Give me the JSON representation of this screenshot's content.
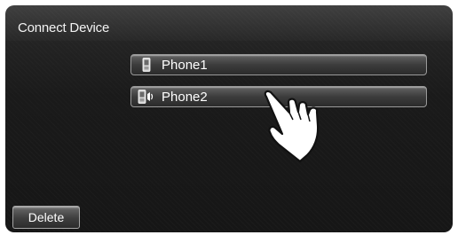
{
  "screen": {
    "title": "Connect Device"
  },
  "devices": [
    {
      "label": "Phone1",
      "icon": "phone-icon"
    },
    {
      "label": "Phone2",
      "icon": "phone-audio-icon"
    }
  ],
  "footer": {
    "delete_label": "Delete"
  },
  "overlay": {
    "icon": "hand-pointer-icon"
  },
  "colors": {
    "background": "#1c1c1c",
    "text": "#ffffff",
    "row_border": "#9a9a9a"
  }
}
